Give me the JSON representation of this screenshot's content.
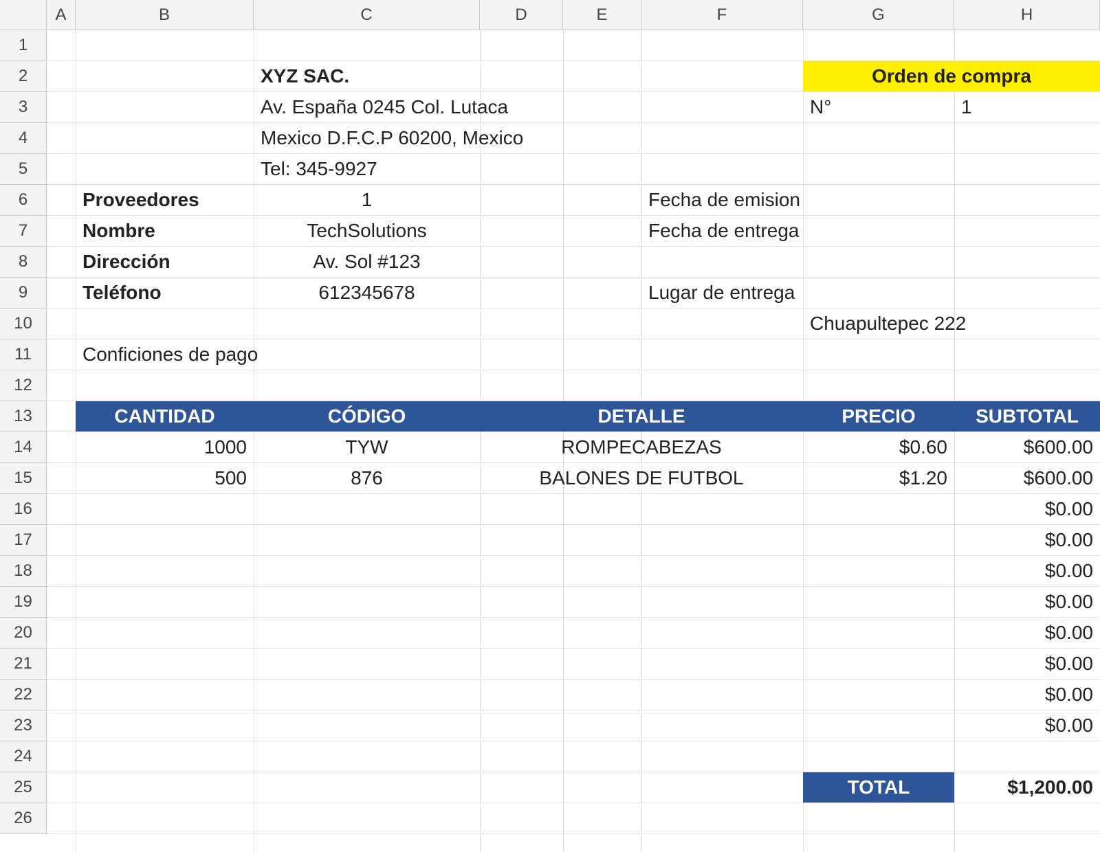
{
  "columns": [
    "A",
    "B",
    "C",
    "D",
    "E",
    "F",
    "G",
    "H"
  ],
  "rows": [
    "1",
    "2",
    "3",
    "4",
    "5",
    "6",
    "7",
    "8",
    "9",
    "10",
    "11",
    "12",
    "13",
    "14",
    "15",
    "16",
    "17",
    "18",
    "19",
    "20",
    "21",
    "22",
    "23",
    "24",
    "25",
    "26"
  ],
  "company": {
    "name": "XYZ SAC.",
    "address1": "Av. España 0245 Col. Lutaca",
    "address2": "Mexico D.F.C.P 60200, Mexico",
    "phone": "Tel: 345-9927"
  },
  "order": {
    "title": "Orden de compra",
    "number_label": "N°",
    "number_value": "1"
  },
  "supplier": {
    "proveedores_label": "Proveedores",
    "proveedores_value": "1",
    "nombre_label": "Nombre",
    "nombre_value": "TechSolutions",
    "direccion_label": "Dirección",
    "direccion_value": "Av. Sol #123",
    "telefono_label": "Teléfono",
    "telefono_value": "612345678"
  },
  "dates": {
    "emision_label": "Fecha de emision",
    "entrega_label": "Fecha de entrega",
    "lugar_label": "Lugar de entrega",
    "lugar_value": "Chuapultepec 222"
  },
  "payment_label": "Conficiones de pago",
  "table": {
    "headers": [
      "CANTIDAD",
      "CÓDIGO",
      "DETALLE",
      "PRECIO",
      "SUBTOTAL"
    ],
    "items": [
      {
        "cantidad": "1000",
        "codigo": "TYW",
        "detalle": "ROMPECABEZAS",
        "precio": "$0.60",
        "subtotal": "$600.00"
      },
      {
        "cantidad": "500",
        "codigo": "876",
        "detalle": "BALONES DE FUTBOL",
        "precio": "$1.20",
        "subtotal": "$600.00"
      }
    ],
    "empty_subtotals": [
      "$0.00",
      "$0.00",
      "$0.00",
      "$0.00",
      "$0.00",
      "$0.00",
      "$0.00",
      "$0.00"
    ],
    "total_label": "TOTAL",
    "total_value": "$1,200.00"
  },
  "colors": {
    "header_fill": "#2d5597",
    "title_fill": "#ffef00"
  }
}
